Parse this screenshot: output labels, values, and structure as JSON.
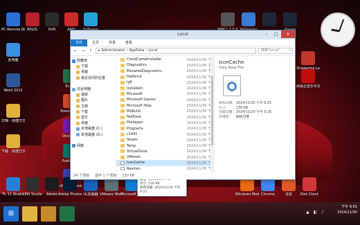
{
  "desktop": {
    "icons_left": [
      {
        "label": "PC Remote Receiver",
        "color": "#2a6fd6"
      },
      {
        "label": "此电脑",
        "color": "#3b8fe0"
      },
      {
        "label": "Word 2013",
        "color": "#2b579a"
      },
      {
        "label": "文档 - 快捷方式",
        "color": "#e2b13c"
      },
      {
        "label": "下载 - 快捷方式",
        "color": "#e2b13c"
      }
    ],
    "icons_row2": [
      {
        "label": "Excel",
        "color": "#217346"
      },
      {
        "label": "PowerPoint",
        "color": "#d24726"
      },
      {
        "label": "OneNote",
        "color": "#7719aa"
      },
      {
        "label": "Publisher",
        "color": "#077568"
      },
      {
        "label": "InfoPath Designer",
        "color": "#3b3fb0"
      }
    ],
    "icons_top": [
      {
        "label": "RIGOL",
        "color": "#b7212b"
      },
      {
        "label": "DVR",
        "color": "#2a2a2a"
      },
      {
        "label": "AMD",
        "color": "#c92b2b"
      },
      {
        "label": "Software",
        "color": "#26a0da"
      }
    ],
    "icons_top_right": [
      {
        "label": "MMCL 1.5.9",
        "color": "#555"
      },
      {
        "label": "Wallpaper",
        "color": "#3a7bd5"
      },
      {
        "label": "",
        "color": "#1b2838"
      },
      {
        "label": "Steam",
        "color": "#1b2838"
      }
    ],
    "icons_right": [
      {
        "label": "Shawarma Legend",
        "color": "#c0392b"
      },
      {
        "label": "网易云音乐中文",
        "color": "#c20c0c"
      }
    ],
    "icons_bottom": [
      {
        "label": "FL 11 Studio",
        "color": "#2a7fd4"
      },
      {
        "label": "OBS Studio",
        "color": "#302e31"
      },
      {
        "label": "Adobe",
        "color": "#1c1c1c"
      },
      {
        "label": "Adobe Photoshop",
        "color": "#001e36"
      },
      {
        "label": "UL加速器",
        "color": "#1565c0"
      },
      {
        "label": "VMware Workstation",
        "color": "#607078"
      },
      {
        "label": "Microsoft Edge",
        "color": "#0f7ed4"
      },
      {
        "label": "Windows Media",
        "color": "#ea6a14"
      },
      {
        "label": "Chrome",
        "color": "#4285f4"
      },
      {
        "label": "全屏",
        "color": "#e05a2a"
      },
      {
        "label": "Riot Client",
        "color": "#d13639"
      }
    ]
  },
  "window": {
    "title": "Local",
    "controls": {
      "minimize": "–",
      "maximize": "□",
      "close": "✕"
    },
    "ribbon_tabs": [
      "文件",
      "主页",
      "共享",
      "查看"
    ],
    "address_parts": [
      "Administrator",
      "AppData",
      "Local"
    ],
    "search_placeholder": "搜索\"Local\"",
    "nav_items": [
      {
        "label": "收藏夹",
        "kind": "star"
      },
      {
        "label": "下载",
        "kind": "folder"
      },
      {
        "label": "桌面",
        "kind": "folder"
      },
      {
        "label": "最近访问的位置",
        "kind": "folder"
      },
      {
        "label": "",
        "kind": "gap"
      },
      {
        "label": "这台电脑",
        "kind": "pc"
      },
      {
        "label": "视频",
        "kind": "folder"
      },
      {
        "label": "图片",
        "kind": "folder"
      },
      {
        "label": "文档",
        "kind": "folder"
      },
      {
        "label": "下载",
        "kind": "folder"
      },
      {
        "label": "音乐",
        "kind": "folder"
      },
      {
        "label": "桌面",
        "kind": "folder"
      },
      {
        "label": "本地磁盘 (C:)",
        "kind": "pc"
      },
      {
        "label": "本地磁盘 (D:)",
        "kind": "pc"
      },
      {
        "label": "",
        "kind": "gap"
      },
      {
        "label": "网络",
        "kind": "netw"
      }
    ],
    "files": [
      {
        "name": "CloudCamelInstaller",
        "date": "2024/11/30 下午",
        "kind": "folder"
      },
      {
        "name": "Diagnostics",
        "date": "2024/11/30 下午",
        "kind": "folder"
      },
      {
        "name": "ElevatedDiagnostics",
        "date": "2024/11/30 下午",
        "kind": "folder"
      },
      {
        "name": "Hallbrick",
        "date": "2024/11/30 下午",
        "kind": "folder"
      },
      {
        "name": "Igfl",
        "date": "2024/11/30 下午",
        "kind": "folder"
      },
      {
        "name": "Installwin",
        "date": "2024/11/30 下午",
        "kind": "folder"
      },
      {
        "name": "Microsoft",
        "date": "2024/11/30 下午",
        "kind": "folder"
      },
      {
        "name": "Microsoft Games",
        "date": "2024/11/30 下午",
        "kind": "folder"
      },
      {
        "name": "Microsoft Help",
        "date": "2024/11/30 下午",
        "kind": "folder"
      },
      {
        "name": "MSBuild",
        "date": "2024/11/30 下午",
        "kind": "folder"
      },
      {
        "name": "NetEase",
        "date": "2024/11/30 下午",
        "kind": "folder"
      },
      {
        "name": "Packages",
        "date": "2024/11/30 下午",
        "kind": "folder"
      },
      {
        "name": "Programs",
        "date": "2024/11/30 下午",
        "kind": "folder"
      },
      {
        "name": "c1941",
        "date": "2024/11/30 下午",
        "kind": "folder"
      },
      {
        "name": "Steam",
        "date": "2024/11/30 下午",
        "kind": "folder"
      },
      {
        "name": "Temp",
        "date": "2024/11/30 下午",
        "kind": "folder"
      },
      {
        "name": "VirtualStore",
        "date": "2024/11/30 下午",
        "kind": "folder"
      },
      {
        "name": "VMware",
        "date": "2024/11/30 下午",
        "kind": "folder"
      },
      {
        "name": "IconCache",
        "date": "2024/11/30 下午",
        "kind": "file",
        "selected": true
      },
      {
        "name": "Resmon",
        "date": "2024/11/30 下午",
        "kind": "file"
      }
    ],
    "tooltip": [
      "类型: Data Base File",
      "大小: 130 KB",
      "修改日期: 2024/11/30 下午 9:25"
    ],
    "preview": {
      "name": "IconCache",
      "type": "Data Base File",
      "meta": [
        {
          "k": "修改日期:",
          "v": "2024/11/30 下午 9:25"
        },
        {
          "k": "大小:",
          "v": "130 KB"
        },
        {
          "k": "创建日期:",
          "v": "2024/11/29 下午 9:26"
        },
        {
          "k": "可用性:",
          "v": "脱机可用"
        }
      ]
    },
    "status": {
      "count": "24 个项目",
      "selected": "选中 1 个项目",
      "size": "130 KB"
    }
  },
  "taskbar": {
    "apps": [
      {
        "name": "windows",
        "glyph": "⊞",
        "color": "#1f6fd0"
      },
      {
        "name": "explorer",
        "glyph": "",
        "color": "#e3b341"
      },
      {
        "name": "file-manager",
        "glyph": "",
        "color": "#c78a2a"
      },
      {
        "name": "excel",
        "glyph": "",
        "color": "#217346"
      }
    ],
    "time": "下午 9:01",
    "date": "2024/11/30"
  }
}
